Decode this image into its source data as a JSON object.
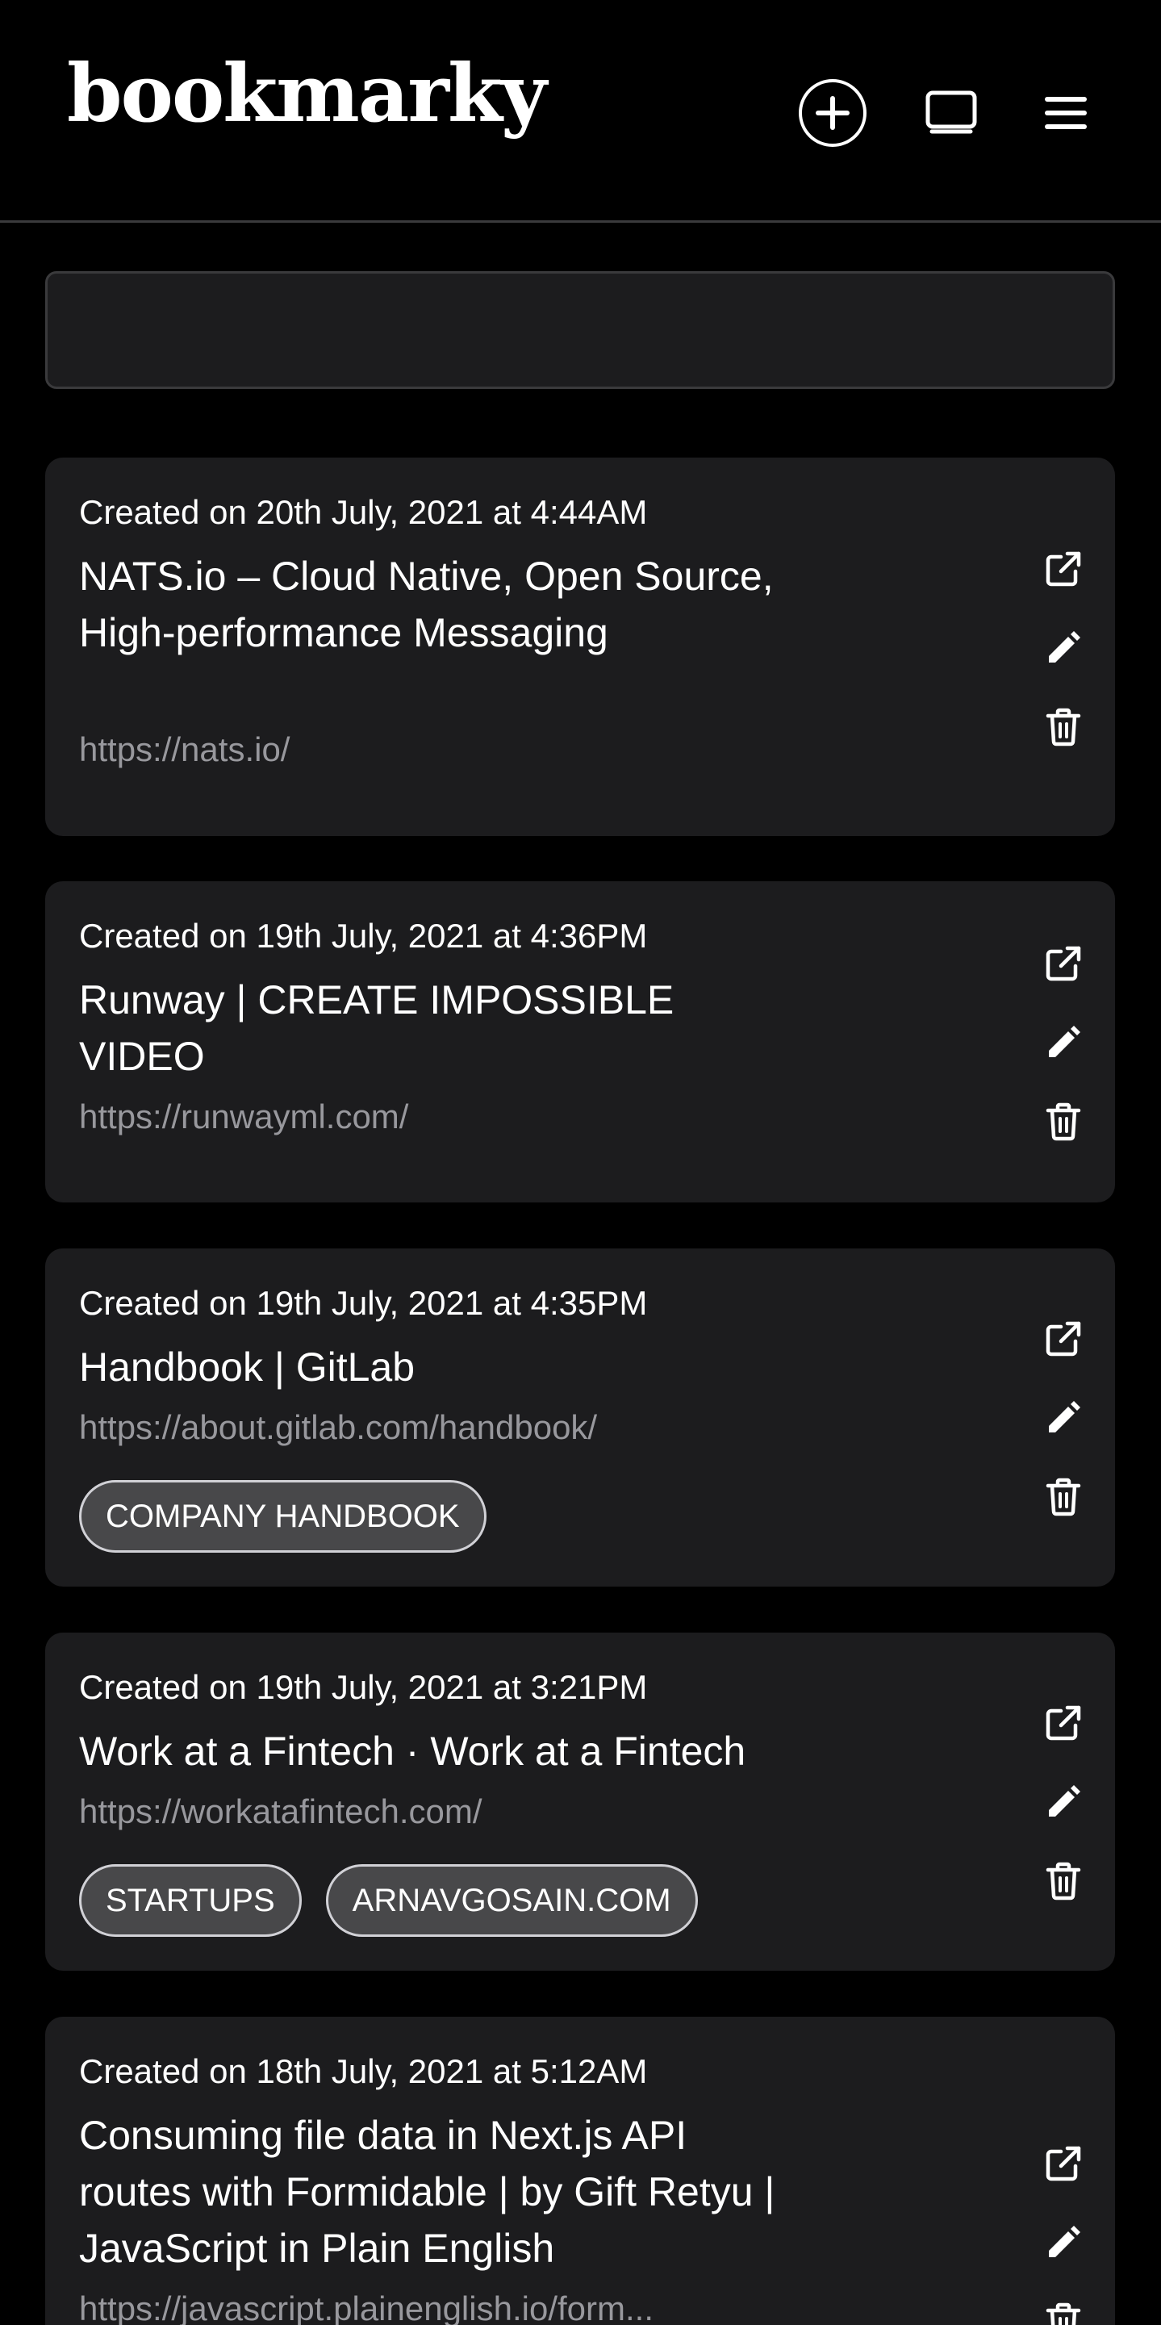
{
  "app": {
    "logo": "bookmarky",
    "search_value": "",
    "icons": {
      "add": "plus-circle-icon",
      "view": "screen-icon",
      "menu": "hamburger-icon",
      "open": "external-link-icon",
      "edit": "pencil-icon",
      "delete": "trash-icon"
    }
  },
  "bookmarks": [
    {
      "date": "Created on 20th July, 2021 at 4:44AM",
      "title": "NATS.io – Cloud Native, Open Source, High-performance Messaging",
      "url": "https://nats.io/",
      "tags": []
    },
    {
      "date": "Created on 19th July, 2021 at 4:36PM",
      "title": "Runway | CREATE IMPOSSIBLE VIDEO",
      "url": "https://runwayml.com/",
      "tags": []
    },
    {
      "date": "Created on 19th July, 2021 at 4:35PM",
      "title": "Handbook | GitLab",
      "url": "https://about.gitlab.com/handbook/",
      "tags": [
        "COMPANY HANDBOOK"
      ]
    },
    {
      "date": "Created on 19th July, 2021 at 3:21PM",
      "title": "Work at a Fintech · Work at a Fintech",
      "url": "https://workatafintech.com/",
      "tags": [
        "STARTUPS",
        "ARNAVGOSAIN.COM"
      ]
    },
    {
      "date": "Created on 18th July, 2021 at 5:12AM",
      "title": "Consuming file data in Next.js API routes with Formidable | by Gift Retyu | JavaScript in Plain English",
      "url": "https://javascript.plainenglish.io/form...",
      "tags": []
    }
  ],
  "colors": {
    "background": "#000000",
    "card": "#1c1c1e",
    "url_text": "#98989d",
    "tag_bg": "#48484a",
    "tag_border": "#d1d1d6"
  }
}
